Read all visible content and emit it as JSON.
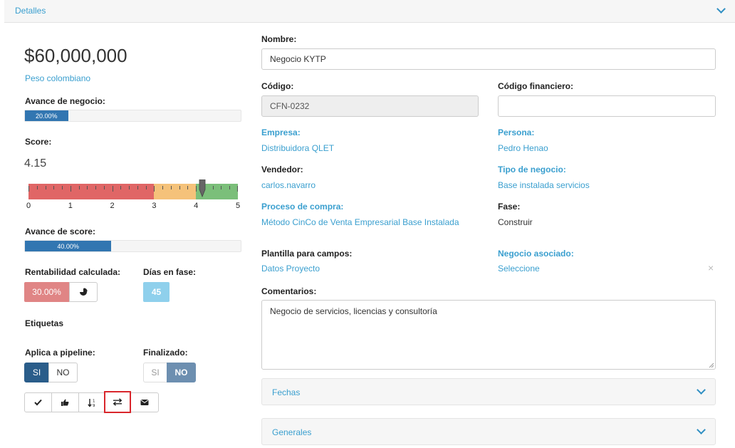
{
  "header": {
    "title": "Detalles"
  },
  "summary": {
    "amount": "$60,000,000",
    "currency": "Peso colombiano",
    "deal_progress_label": "Avance de negocio:",
    "deal_progress_text": "20.00%",
    "deal_progress_value": 0.2,
    "score_label": "Score:",
    "score_value": "4.15",
    "score_numeric": 4.15,
    "gauge": {
      "min": 0,
      "max": 5,
      "ticks": [
        "0",
        "1",
        "2",
        "3",
        "4",
        "5"
      ],
      "zones": [
        {
          "from": 0,
          "to": 3,
          "color": "#e06666"
        },
        {
          "from": 3,
          "to": 4,
          "color": "#f5c27a"
        },
        {
          "from": 4,
          "to": 5,
          "color": "#7bbf7a"
        }
      ]
    },
    "score_progress_label": "Avance de score:",
    "score_progress_text": "40.00%",
    "score_progress_value": 0.4,
    "profitability_label": "Rentabilidad calculada:",
    "profitability_value": "30.00%",
    "days_label": "Días en fase:",
    "days_value": "45",
    "tags_label": "Etiquetas",
    "pipeline_label": "Aplica a pipeline:",
    "pipeline_yes": "SI",
    "pipeline_no": "NO",
    "pipeline_selected": "SI",
    "finalized_label": "Finalizado:",
    "finalized_yes": "SI",
    "finalized_no": "NO",
    "finalized_selected": "NO"
  },
  "toolbar": {
    "icons": [
      "check-icon",
      "thumbs-up-icon",
      "sort-numeric-icon",
      "exchange-icon",
      "envelope-icon"
    ],
    "highlighted": "exchange-icon"
  },
  "form": {
    "name_label": "Nombre:",
    "name_value": "Negocio KYTP",
    "code_label": "Código:",
    "code_value": "CFN-0232",
    "fin_code_label": "Código financiero:",
    "fin_code_value": "",
    "company_label": "Empresa:",
    "company_value": "Distribuidora QLET",
    "person_label": "Persona:",
    "person_value": "Pedro Henao",
    "seller_label": "Vendedor:",
    "seller_value": "carlos.navarro",
    "deal_type_label": "Tipo de negocio:",
    "deal_type_value": "Base instalada servicios",
    "process_label": "Proceso de compra:",
    "process_value": "Método CinCo de Venta Empresarial Base Instalada",
    "phase_label": "Fase:",
    "phase_value": "Construir",
    "template_label": "Plantilla para campos:",
    "template_value": "Datos Proyecto",
    "assoc_label": "Negocio asociado:",
    "assoc_value": "Seleccione",
    "comments_label": "Comentarios:",
    "comments_value": "Negocio de servicios, licencias y consultoría"
  },
  "panels": {
    "dates": "Fechas",
    "general": "Generales"
  },
  "colors": {
    "accent": "#3a9fcf",
    "primary": "#3276b1",
    "danger": "#e08585",
    "info": "#8fd0ec",
    "highlight": "#d9262c"
  }
}
